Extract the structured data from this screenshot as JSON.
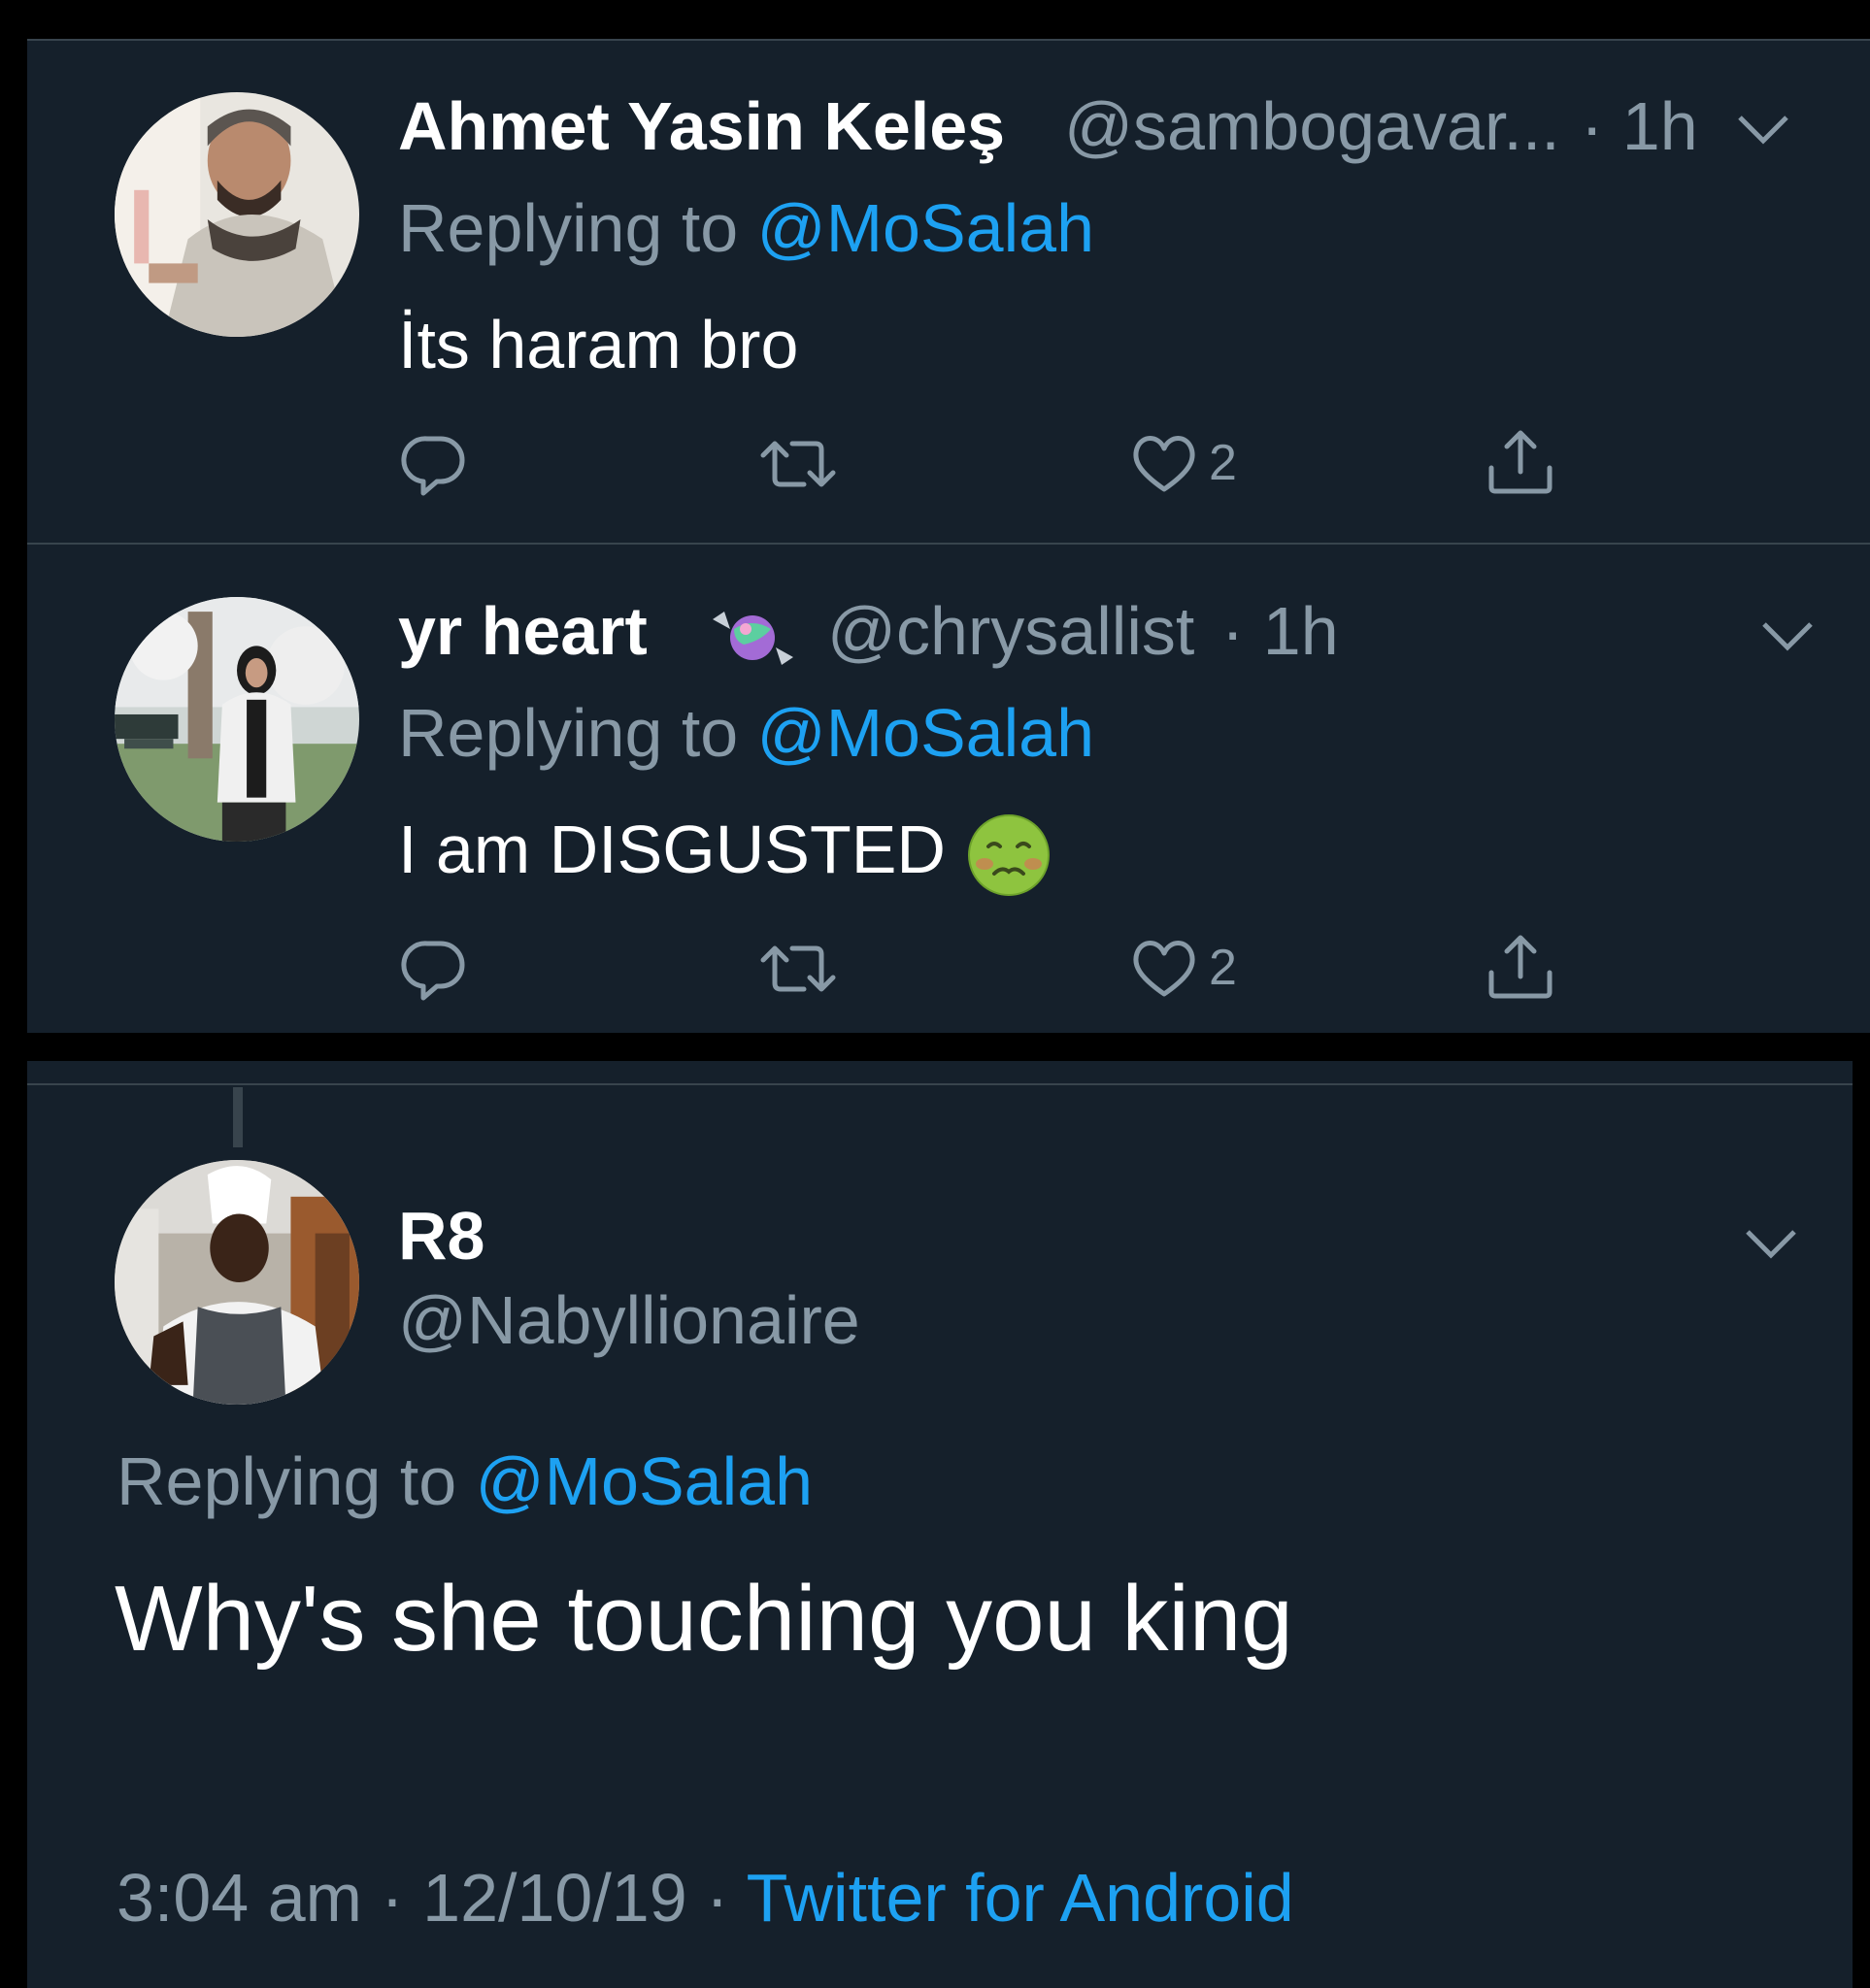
{
  "colors": {
    "background": "#15202b",
    "outer": "#000000",
    "divider": "#38444d",
    "secondary_text": "#8899a6",
    "link": "#1da1f2",
    "primary_text": "#ffffff"
  },
  "replies": [
    {
      "display_name": "Ahmet Yasin Keleş",
      "handle": "@sambogavar...",
      "time": "· 1h",
      "replying_label": "Replying to",
      "replying_to": "@MoSalah",
      "text": "İts haram bro",
      "likes": "2",
      "icons": [
        "reply-icon",
        "retweet-icon",
        "like-icon",
        "share-icon",
        "chevron-down-icon"
      ]
    },
    {
      "display_name": "yr heart",
      "name_emoji": "candy-emoji",
      "handle": "@chrysallist",
      "time": "· 1h",
      "replying_label": "Replying to",
      "replying_to": "@MoSalah",
      "text": "I am DISGUSTED",
      "text_emoji": "nauseated-face-emoji",
      "likes": "2",
      "icons": [
        "reply-icon",
        "retweet-icon",
        "like-icon",
        "share-icon",
        "chevron-down-icon"
      ]
    }
  ],
  "main_tweet": {
    "display_name": "R8",
    "handle": "@Nabyllionaire",
    "replying_label": "Replying to",
    "replying_to": "@MoSalah",
    "text": "Why's she touching you king",
    "time": "3:04 am",
    "date": "12/10/19",
    "separator": "·",
    "source": "Twitter for Android"
  }
}
